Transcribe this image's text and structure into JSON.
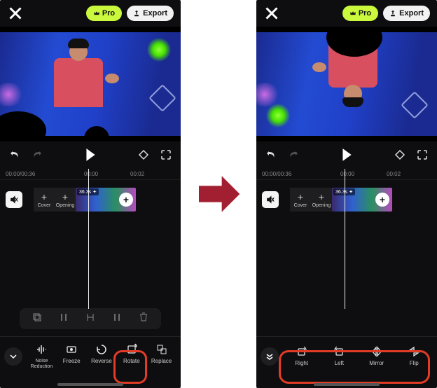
{
  "topbar": {
    "pro_label": "Pro",
    "export_label": "Export"
  },
  "time": {
    "current": "00:00",
    "total": "00:36",
    "tick1": "00:00",
    "tick2": "00:02"
  },
  "timeline": {
    "cover_label": "Cover",
    "opening_label": "Opening",
    "clip_badge": "36.3s"
  },
  "toolbar_left": {
    "noise": "Noise\nReduction",
    "freeze": "Freeze",
    "reverse": "Reverse",
    "rotate": "Rotate",
    "replace": "Replace"
  },
  "toolbar_right": {
    "right": "Right",
    "left": "Left",
    "mirror": "Mirror",
    "flip": "Flip"
  }
}
